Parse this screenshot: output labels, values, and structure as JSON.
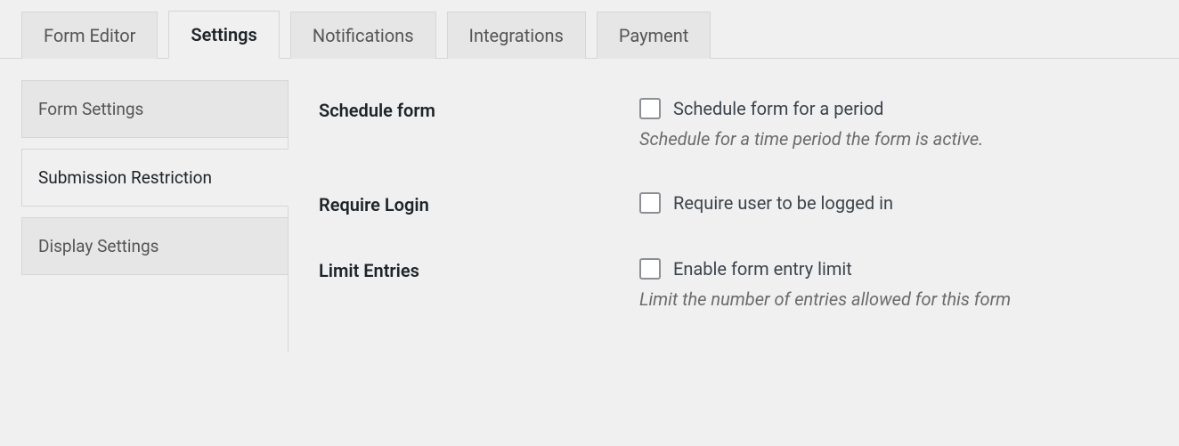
{
  "tabs": [
    {
      "label": "Form Editor"
    },
    {
      "label": "Settings"
    },
    {
      "label": "Notifications"
    },
    {
      "label": "Integrations"
    },
    {
      "label": "Payment"
    }
  ],
  "active_tab_index": 1,
  "side_items": [
    {
      "label": "Form Settings"
    },
    {
      "label": "Submission Restriction"
    },
    {
      "label": "Display Settings"
    }
  ],
  "active_side_index": 1,
  "settings": {
    "schedule": {
      "heading": "Schedule form",
      "checkbox_label": "Schedule form for a period",
      "description": "Schedule for a time period the form is active."
    },
    "require_login": {
      "heading": "Require Login",
      "checkbox_label": "Require user to be logged in"
    },
    "limit_entries": {
      "heading": "Limit Entries",
      "checkbox_label": "Enable form entry limit",
      "description": "Limit the number of entries allowed for this form"
    }
  }
}
